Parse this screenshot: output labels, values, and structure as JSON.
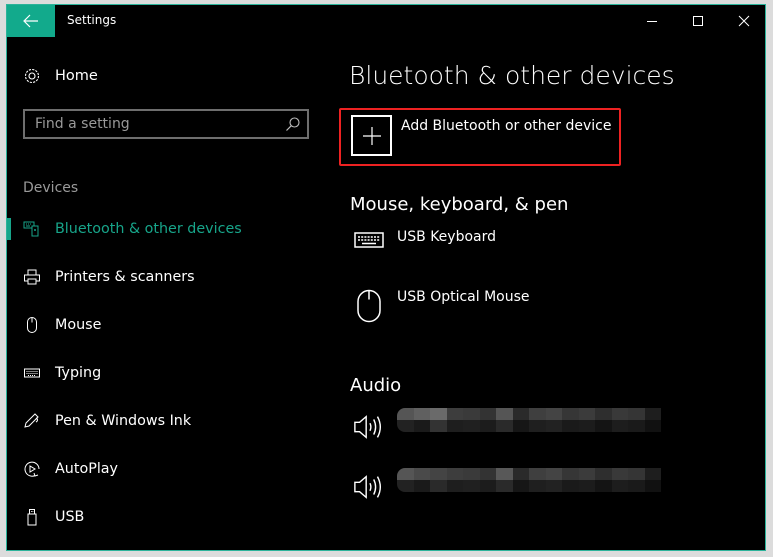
{
  "window": {
    "title": "Settings",
    "accent_color": "#12aa8c",
    "controls": {
      "minimize": "minimize",
      "maximize": "maximize",
      "close": "close"
    }
  },
  "sidebar": {
    "home_label": "Home",
    "search": {
      "placeholder": "Find a setting",
      "value": ""
    },
    "section_label": "Devices",
    "items": [
      {
        "label": "Bluetooth & other devices",
        "icon": "bluetooth-devices-icon",
        "active": true
      },
      {
        "label": "Printers & scanners",
        "icon": "printer-icon",
        "active": false
      },
      {
        "label": "Mouse",
        "icon": "mouse-icon",
        "active": false
      },
      {
        "label": "Typing",
        "icon": "keyboard-icon",
        "active": false
      },
      {
        "label": "Pen & Windows Ink",
        "icon": "pen-icon",
        "active": false
      },
      {
        "label": "AutoPlay",
        "icon": "autoplay-icon",
        "active": false
      },
      {
        "label": "USB",
        "icon": "usb-icon",
        "active": false
      }
    ]
  },
  "main": {
    "title": "Bluetooth & other devices",
    "add_device_label": "Add Bluetooth or other device",
    "highlight_color": "#ee2222",
    "groups": [
      {
        "title": "Mouse, keyboard, & pen",
        "devices": [
          {
            "name": "USB Keyboard",
            "icon": "keyboard-icon"
          },
          {
            "name": "USB Optical Mouse",
            "icon": "mouse-icon"
          }
        ]
      },
      {
        "title": "Audio",
        "devices": [
          {
            "name": "[redacted]",
            "icon": "speaker-icon"
          },
          {
            "name": "[redacted]",
            "icon": "speaker-icon"
          }
        ]
      }
    ]
  }
}
